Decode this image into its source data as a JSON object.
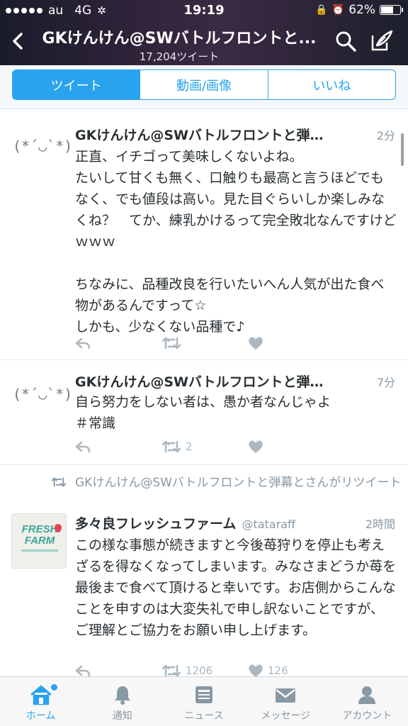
{
  "status": {
    "carrier": "au",
    "network": "4G",
    "time": "19:19",
    "battery_text": "62%",
    "battery_level": 0.62
  },
  "header": {
    "title": "GKけんけん@SWバトルフロントと...",
    "tweet_count": "17,204ツイート"
  },
  "tabs": [
    {
      "label": "ツイート",
      "active": true
    },
    {
      "label": "動画/画像",
      "active": false
    },
    {
      "label": "いいね",
      "active": false
    }
  ],
  "tweets": [
    {
      "avatar": "(*´◡`*)",
      "name": "GKけんけん@SWバトルフロントと弾…",
      "time": "2分",
      "text": "正直、イチゴって美味しくないよね。\nたいして甘くも無く、口触りも最高と言うほどでもなく、でも値段は高い。見た目ぐらいしか楽しみなくね？　てか、練乳かけるって完全敗北なんですけどｗｗｗ\n\nちなみに、品種改良を行いたいへん人気が出た食べ物があるんですって☆\nしかも、少なくない品種で♪",
      "retweets": "",
      "likes": ""
    },
    {
      "avatar": "(*´◡`*)",
      "name": "GKけんけん@SWバトルフロントと弾…",
      "time": "7分",
      "text": "自ら努力をしない者は、愚か者なんじゃよ\n＃常識",
      "retweets": "2",
      "likes": ""
    },
    {
      "retweeted_by": "GKけんけん@SWバトルフロントと弾幕とさんがリツイート",
      "avatar_text_1": "FRESH",
      "avatar_text_2": "FARM",
      "name": "多々良フレッシュファーム",
      "handle": "@tataraff",
      "time": "2時間",
      "text": "この様な事態が続きますと今後苺狩りを停止も考えざるを得なくなってしまいます。みなさまどうか苺を最後まで食べて頂けると幸いです。お店側からこんなことを申すのは大変失礼で申し訳ないことですが、ご理解とご協力をお願い申し上げます。",
      "retweets": "1206",
      "likes": "126"
    }
  ],
  "bottom_tabs": [
    {
      "label": "ホーム",
      "icon": "home-icon",
      "active": true
    },
    {
      "label": "通知",
      "icon": "bell-icon",
      "active": false
    },
    {
      "label": "ニュース",
      "icon": "news-icon",
      "active": false
    },
    {
      "label": "メッセージ",
      "icon": "envelope-icon",
      "active": false
    },
    {
      "label": "アカウント",
      "icon": "person-icon",
      "active": false
    }
  ],
  "colors": {
    "accent": "#2aa3ef",
    "muted": "#8899a6",
    "action": "#aab8c2"
  }
}
